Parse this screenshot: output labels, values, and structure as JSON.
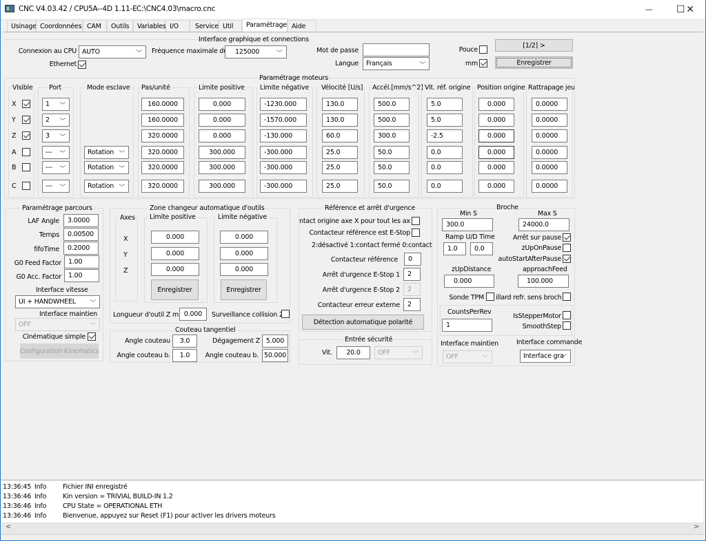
{
  "window": {
    "title": "CNC V4.03.42 / CPU5A--4D 1.11-E",
    "path": "C:\\CNC4.03\\macro.cnc",
    "minimize": "—",
    "maximize": "☐",
    "close": "✕"
  },
  "tabs": [
    "Usinage",
    "Coordonnées",
    "CAM",
    "Outils",
    "Variables",
    "I/O",
    "Service",
    "Util",
    "Paramétrage",
    "Aide"
  ],
  "active_tab": "Paramétrage",
  "interface": {
    "title": "Interface graphique et connections",
    "cpu_label": "Connexion au CPU",
    "cpu_value": "AUTO",
    "ethernet_label": "Ethernet",
    "ethernet_checked": true,
    "freq_label": "Fréquence maximale du",
    "freq_value": "125000",
    "password_label": "Mot de passe",
    "password_value": "",
    "lang_label": "Langue",
    "lang_value": "Français",
    "inch_label": "Pouce",
    "inch_checked": false,
    "mm_label": "mm",
    "mm_checked": true,
    "page_button": "[1/2] >",
    "save_button": "Enregistrer"
  },
  "motors": {
    "title": "Paramétrage moteurs",
    "headers": {
      "visible": "Visible",
      "port": "Port",
      "slave": "Mode esclave",
      "steps": "Pas/unité",
      "poslimit": "Limite positive",
      "neglimit": "Limite négative",
      "velocity": "Vélocité [U/s]",
      "accel": "Accél.[mm/s^2]",
      "homespeed": "Vit. réf. origine",
      "homepos": "Position origine",
      "backlash": "Rattrapage jeu"
    },
    "rows": [
      {
        "axis": "X",
        "visible": true,
        "port": "1",
        "slave": "",
        "steps": "160.0000",
        "pos": "0.000",
        "neg": "-1230.000",
        "vel": "130.0",
        "acc": "500.0",
        "hs": "5.0",
        "hp": "0.000",
        "bl": "0.0000"
      },
      {
        "axis": "Y",
        "visible": true,
        "port": "2",
        "slave": "",
        "steps": "160.0000",
        "pos": "0.000",
        "neg": "-1570.000",
        "vel": "130.0",
        "acc": "500.0",
        "hs": "5.0",
        "hp": "0.000",
        "bl": "0.0000"
      },
      {
        "axis": "Z",
        "visible": true,
        "port": "3",
        "slave": "",
        "steps": "320.0000",
        "pos": "0.000",
        "neg": "-130.000",
        "vel": "60.0",
        "acc": "300.0",
        "hs": "-2.5",
        "hp": "0.000",
        "bl": "0.0000"
      },
      {
        "axis": "A",
        "visible": false,
        "port": "---",
        "slave": "Rotation",
        "steps": "320.0000",
        "pos": "300.000",
        "neg": "-300.000",
        "vel": "25.0",
        "acc": "50.0",
        "hs": "0.0",
        "hp": "0.000",
        "bl": "0.0000"
      },
      {
        "axis": "B",
        "visible": false,
        "port": "---",
        "slave": "Rotation",
        "steps": "320.0000",
        "pos": "300.000",
        "neg": "-300.000",
        "vel": "25.0",
        "acc": "50.0",
        "hs": "0.0",
        "hp": "0.000",
        "bl": "0.0000"
      },
      {
        "axis": "C",
        "visible": false,
        "port": "---",
        "slave": "Rotation",
        "steps": "320.0000",
        "pos": "300.000",
        "neg": "-300.000",
        "vel": "25.0",
        "acc": "50.0",
        "hs": "0.0",
        "hp": "0.000",
        "bl": "0.0000"
      }
    ]
  },
  "path": {
    "title": "Paramétrage parcours",
    "laf_label": "LAF Angle",
    "laf_value": "3.0000",
    "time_label": "Temps",
    "time_value": "0.00500",
    "fifo_label": "fifoTime",
    "fifo_value": "0.2000",
    "g0feed_label": "G0 Feed Factor",
    "g0feed_value": "1.00",
    "g0acc_label": "G0 Acc. Factor",
    "g0acc_value": "1.00",
    "speed_if_label": "Interface vitesse",
    "speed_if_value": "UI + HANDWHEEL",
    "hold_if_label": "Interface maintien",
    "hold_if_value": "OFF",
    "kin_label": "Cinématique simple",
    "kin_checked": true,
    "kin_button": "Configuration Kinematics"
  },
  "toolchanger": {
    "title": "Zone changeur automatique d'outils",
    "axes_label": "Axes",
    "axes": [
      "X",
      "Y",
      "Z"
    ],
    "pos_label": "Limite positive",
    "neg_label": "Limite négative",
    "pos_values": [
      "0.000",
      "0.000",
      "0.000"
    ],
    "neg_values": [
      "0.000",
      "0.000",
      "0.000"
    ],
    "save_pos": "Enregistrer",
    "save_neg": "Enregistrer",
    "minlen_label": "Longueur d'outil Z min",
    "minlen_value": "0.000",
    "collision_label": "Surveillance collision Z",
    "collision_checked": false
  },
  "knife": {
    "title": "Couteau tangentiel",
    "angle_label": "Angle couteau",
    "angle_value": "3.0",
    "angleb_label": "Angle couteau b.",
    "angleb_value": "1.0",
    "lift_label": "Dégagement Z",
    "lift_value": "5.000",
    "angleb2_label": "Angle couteau b.",
    "angleb2_value": "50.000"
  },
  "reference": {
    "title": "Référence et arrêt d'urgence",
    "xhome_label": "ntact origine axe X pour tout les axes",
    "xhome_checked": false,
    "estop_ref_label": "Contacteur référence est E-Stop",
    "estop_ref_checked": false,
    "legend": "2:désactivé 1:contact fermé 0:contact",
    "ref_label": "Contacteur référence",
    "ref_value": "0",
    "estop1_label": "Arrêt d'urgence E-Stop 1",
    "estop1_value": "2",
    "estop2_label": "Arrêt d'urgence E-Stop 2",
    "estop2_value": "2",
    "ext_label": "Contacteur erreur externe",
    "ext_value": "2",
    "detect_button": "Détection automatique polarité"
  },
  "safety": {
    "title": "Entrée sécurité",
    "speed_label": "Vit.",
    "speed_value": "20.0",
    "mode_value": "OFF"
  },
  "spindle": {
    "title": "Broche",
    "mins_label": "Min S",
    "mins_value": "300.0",
    "maxs_label": "Max S",
    "maxs_value": "24000.0",
    "ramp_label": "Ramp U/D Time",
    "ramp_up": "1.0",
    "ramp_down": "0.0",
    "stop_pause_label": "Arrêt sur pause",
    "stop_pause_checked": true,
    "zup_pause_label": "zUpOnPause",
    "zup_pause_checked": false,
    "autostart_label": "autoStartAfterPause",
    "autostart_checked": true,
    "zupdist_label": "zUpDistance",
    "zupdist_value": "0.000",
    "approach_label": "approachFeed",
    "approach_value": "100.000",
    "tpm_label": "Sonde TPM",
    "tpm_checked": false,
    "dir_label": "illard refr. sens broche",
    "dir_checked": false,
    "counts_label": "CountsPerRev",
    "counts_value": "1",
    "stepper_label": "IsStepperMotor",
    "stepper_checked": false,
    "smooth_label": "SmoothStep",
    "smooth_checked": false,
    "hold_label": "Interface maintien",
    "hold_value": "OFF",
    "cmd_label": "Interface commande",
    "cmd_value": "Interface gra"
  },
  "log": [
    {
      "time": "13:36:45",
      "level": "Info",
      "msg": "Fichier INI enregistré"
    },
    {
      "time": "13:36:46",
      "level": "Info",
      "msg": "Kin version = TRIVIAL BUILD-IN 1.2"
    },
    {
      "time": "13:36:46",
      "level": "Info",
      "msg": "CPU State = OPERATIONAL ETH"
    },
    {
      "time": "13:36:46",
      "level": "Info",
      "msg": "Bienvenue, appuyez sur Reset (F1) pour activer les drivers moteurs"
    }
  ],
  "scroll": {
    "left": "<",
    "right": ">"
  }
}
